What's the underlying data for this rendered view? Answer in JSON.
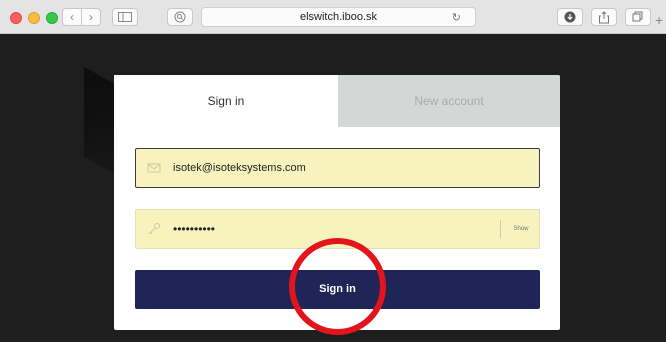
{
  "browser": {
    "url": "elswitch.iboo.sk",
    "icons": {
      "back": "chevron-left-icon",
      "forward": "chevron-right-icon",
      "sidebar": "sidebar-icon",
      "reader": "reader-icon",
      "reload": "reload-icon",
      "download": "download-icon",
      "share": "share-icon",
      "tabs": "tabs-icon",
      "new_tab": "plus-icon"
    },
    "traffic_light_colors": {
      "close": "#fc605c",
      "minimize": "#fdbc40",
      "maximize": "#34c84a"
    }
  },
  "auth": {
    "tabs": [
      {
        "label": "Sign in",
        "active": true
      },
      {
        "label": "New account",
        "active": false
      }
    ],
    "email": {
      "value": "isotek@isoteksystems.com",
      "icon": "mail-icon"
    },
    "password": {
      "value": "••••••••••",
      "icon": "key-icon",
      "show_label": "Show"
    },
    "submit_label": "Sign in"
  },
  "colors": {
    "primary_button": "#1f2557",
    "input_autofill": "#f7f3bf",
    "inactive_tab": "#d3d8d7",
    "highlight_circle": "#e3141b"
  }
}
